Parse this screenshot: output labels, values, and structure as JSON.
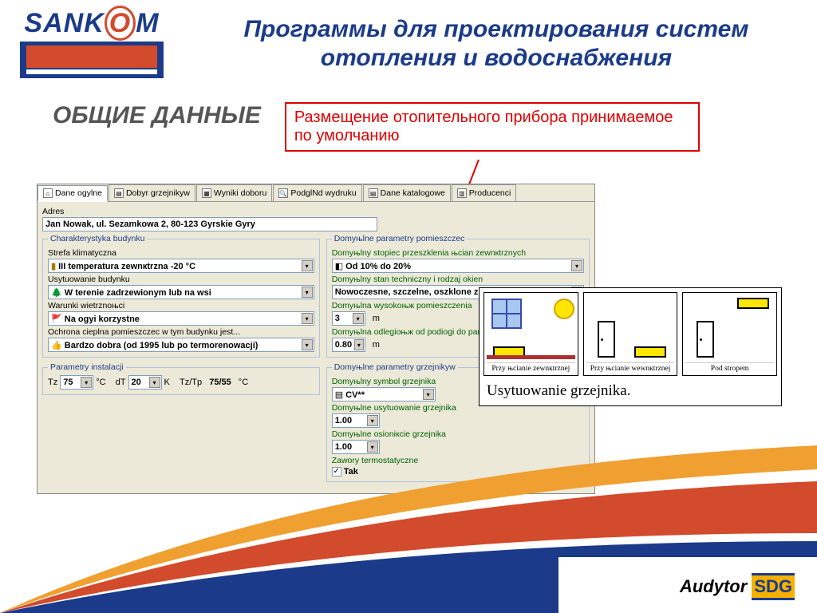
{
  "header": {
    "logo_text": "SANKOM",
    "title": "Программы для проектирования систем отопления и водоснабжения"
  },
  "section_title": "ОБЩИЕ ДАННЫЕ",
  "callout": "Размещение отопительного прибора принимаемое по умолчанию",
  "app": {
    "tabs": [
      "Dane ogуlne",
      "Dobуr grzejnikуw",
      "Wyniki doboru",
      "PodglNd wydruku",
      "Dane katalogowe",
      "Producenci"
    ],
    "adres_label": "Adres",
    "adres_value": "Jan Nowak, ul. Sezamkowa 2, 80-123 Gуrskie Gуry",
    "building_legend": "Charakterystyka budynku",
    "strefa_label": "Strefa klimatyczna",
    "strefa_value": "III temperatura zewnкtrzna -20 °C",
    "usytuowanie_label": "Usytuowanie budynku",
    "usytuowanie_value": "W terenie zadrzewionym lub na wsi",
    "wiatr_label": "Warunki wietrznoњci",
    "wiatr_value": "Na ogуі korzystne",
    "ochrona_label": "Ochrona cieplna pomieszczeс w tym budynku jest...",
    "ochrona_value": "Bardzo dobra (od 1995 lub po termorenowacji)",
    "room_legend": "Domyњlne parametry pomieszczeс",
    "przeszk_label": "Domyњlny stopieс przeszklenia њcian zewnкtrznych",
    "przeszk_value": "Od 10% do 20%",
    "okna_label": "Domyњlny stan techniczny i rodzaj okien",
    "okna_value": "Nowoczesne, szczelne, oszklone z...",
    "wys_label": "Domyњlna wysokoњж pomieszczenia",
    "wys_value": "3",
    "wys_unit": "m",
    "parap_label": "Domyњlna odlegіoњж od podіogi do parap...",
    "parap_value": "0.80",
    "parap_unit": "m",
    "rad_legend": "Domyњlne parametry grzejnikуw",
    "symbol_label": "Domyњlny symbol grzejnika",
    "symbol_value": "CV**",
    "usyt_label": "Domyњlne usytuowanie grzejnika",
    "usyt_value": "1.00",
    "oslon_label": "Domyњlne osіoniкcie grzejnika",
    "oslon_value": "1.00",
    "zawory_label": "Zawory termostatyczne",
    "zawory_value": "Tak",
    "inst_legend": "Parametry instalacji",
    "tz_label": "Tz",
    "tz_value": "75",
    "tz_unit": "°C",
    "dt_label": "dT",
    "dt_value": "20",
    "dt_unit": "K",
    "tztp_label": "Tz/Tp",
    "tztp_value": "75/55",
    "tztp_unit": "°C"
  },
  "popup": {
    "opt1": "Przy њcianie zewnкtrznej",
    "opt2": "Przy њcianie wewnкtrznej",
    "opt3": "Pod stropem",
    "footer": "Usytuowanie grzejnika."
  },
  "brand": {
    "a": "Audytor",
    "b": "SDG"
  }
}
